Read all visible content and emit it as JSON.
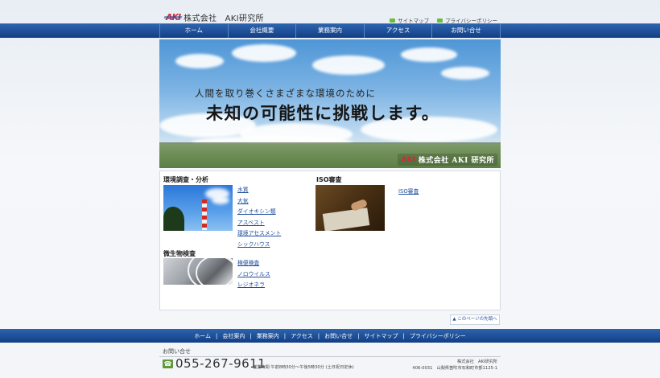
{
  "header": {
    "logo_mark": "AKI",
    "logo_text": "株式会社　AKI研究所",
    "util_links": [
      "サイトマップ",
      "プライバシーポリシー"
    ]
  },
  "gnav": [
    "ホーム",
    "会社概要",
    "業務案内",
    "アクセス",
    "お問い合せ"
  ],
  "hero": {
    "subtitle": "人間を取り巻くさまざまな環境のために",
    "title": "未知の可能性に挑戦します。",
    "brand_mark": "AKI",
    "brand_text": "株式会社 AKI 研究所"
  },
  "sections": {
    "env": {
      "title": "環境調査・分析",
      "links": [
        "水質",
        "大気",
        "ダイオキシン類",
        "アスベスト",
        "環境アセスメント",
        "シックハウス"
      ]
    },
    "micro": {
      "title": "微生物検査",
      "links": [
        "検便検査",
        "ノロウイルス",
        "レジオネラ"
      ]
    },
    "iso": {
      "title": "ISO審査",
      "links": [
        "ISO審査"
      ]
    }
  },
  "pagetop": "▲ このページの先頭へ",
  "fnav": [
    "ホーム",
    "会社案内",
    "業務案内",
    "アクセス",
    "お問い合せ",
    "サイトマップ",
    "プライバシーポリシー"
  ],
  "footer": {
    "contact_label": "お問い合せ",
    "phone": "055-267-9611",
    "hours": "営業時間 午前8時30分〜午後5時30分 (土日祝日定休)",
    "company": "株式会社　AKI研究所",
    "address": "406-0031　山梨県笛吹市石和町市部1125-1"
  }
}
